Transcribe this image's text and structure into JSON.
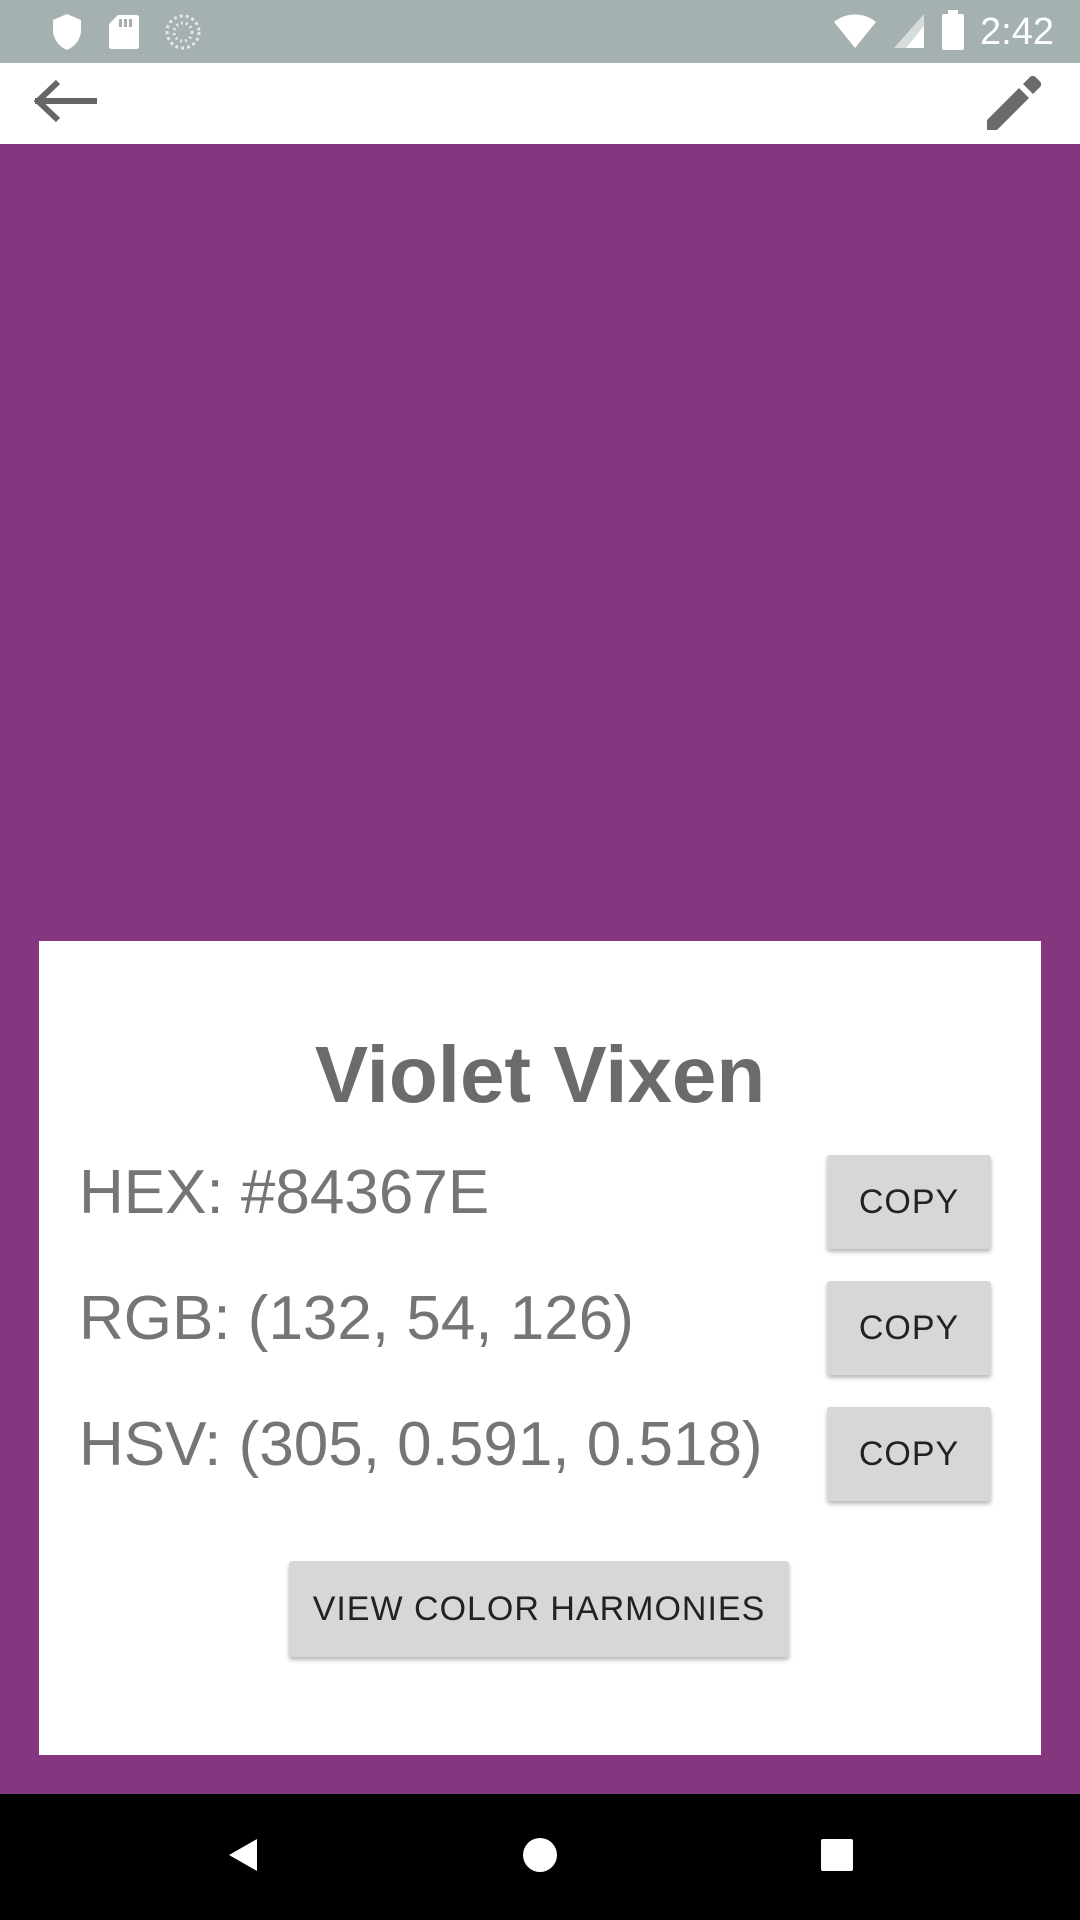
{
  "status_bar": {
    "time": "2:42",
    "icons": [
      "shield-icon",
      "sd-card-icon",
      "sync-icon",
      "wifi-icon",
      "signal-icon",
      "battery-icon"
    ]
  },
  "app_bar": {
    "back_icon": "arrow-back-icon",
    "edit_icon": "pencil-icon"
  },
  "color": {
    "swatch_hex": "#84367E",
    "name": "Violet Vixen",
    "hex_label": "HEX: #84367E",
    "rgb_label": "RGB: (132, 54, 126)",
    "hsv_label": "HSV: (305, 0.591, 0.518)"
  },
  "buttons": {
    "copy_hex": "COPY",
    "copy_rgb": "COPY",
    "copy_hsv": "COPY",
    "view_harmonies": "VIEW COLOR HARMONIES"
  },
  "colors": {
    "status_bar": "#A5B1B0",
    "card": "#FFFFFF",
    "button": "#D6D7D7",
    "text": "#757575"
  }
}
